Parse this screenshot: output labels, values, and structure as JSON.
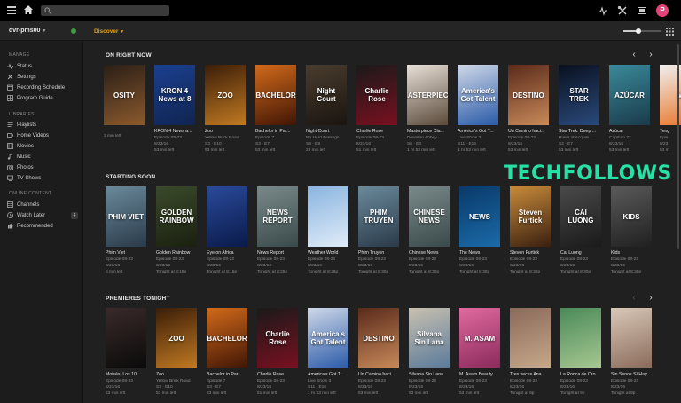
{
  "colors": {
    "accent": "#e5a00d",
    "watermark": "#27e0a6",
    "avatar": "#e5437a"
  },
  "topbar": {
    "search_placeholder": "",
    "avatar_letter": "P"
  },
  "subbar": {
    "server": "dvr-pms00",
    "discover": "Discover"
  },
  "sidebar": {
    "manage_head": "MANAGE",
    "manage": [
      "Status",
      "Settings",
      "Recording Schedule",
      "Program Guide"
    ],
    "libraries_head": "LIBRARIES",
    "libraries": [
      "Playlists",
      "Home Videos",
      "Movies",
      "Music",
      "Photos",
      "TV Shows"
    ],
    "online_head": "ONLINE CONTENT",
    "online": [
      "Channels",
      "Watch Later",
      "Recommended"
    ],
    "watch_later_badge": "4"
  },
  "watermark": "TECHFOLLOWS",
  "hubs": [
    {
      "title": "ON RIGHT NOW",
      "cards": [
        {
          "poster": "OSITY",
          "c1": "#2b1e16",
          "c2": "#8a5a2e",
          "title": "",
          "l2": "",
          "l3": "",
          "l4": "3 min left"
        },
        {
          "poster": "KRON 4 News at 8",
          "c1": "#1c3f8f",
          "c2": "#0f2450",
          "title": "KRON 4 News a...",
          "l2": "Episode 08-23",
          "l3": "8/23/16",
          "l4": "53 min left"
        },
        {
          "poster": "ZOO",
          "c1": "#3b1d08",
          "c2": "#c17a22",
          "title": "Zoo",
          "l2": "Yellow Brick Road",
          "l3": "S3 · E10",
          "l4": "53 min left"
        },
        {
          "poster": "BACHELOR",
          "c1": "#d26a1a",
          "c2": "#401505",
          "title": "Bachelor in Par...",
          "l2": "Episode 7",
          "l3": "S3 · E7",
          "l4": "53 min left"
        },
        {
          "poster": "Night Court",
          "c1": "#4a3d2e",
          "c2": "#1a1410",
          "title": "Night Court",
          "l2": "No Hard Feelings",
          "l3": "S9 · E8",
          "l4": "23 min left"
        },
        {
          "poster": "Charlie Rose",
          "c1": "#1a1a1a",
          "c2": "#7a1020",
          "title": "Charlie Rose",
          "l2": "Episode 08-23",
          "l3": "8/23/16",
          "l4": "51 min left"
        },
        {
          "poster": "MASTERPIECE",
          "c1": "#e8e0d8",
          "c2": "#5a4a3a",
          "title": "Masterpiece Cla...",
          "l2": "Downton Abbey...",
          "l3": "S6 · E3",
          "l4": "1 hr 53 min left"
        },
        {
          "poster": "America's Got Talent",
          "c1": "#cfd8e8",
          "c2": "#2a5aa8",
          "title": "America's Got T...",
          "l2": "Live Show 3",
          "l3": "S11 · E16",
          "l4": "1 hr 53 min left"
        },
        {
          "poster": "DESTINO",
          "c1": "#5a2a1a",
          "c2": "#c88a5a",
          "title": "Un Camino haci...",
          "l2": "Episode 08-23",
          "l3": "8/23/16",
          "l4": "53 min left"
        },
        {
          "poster": "STAR TREK",
          "c1": "#0a1020",
          "c2": "#2a4a7a",
          "title": "Star Trek: Deep ...",
          "l2": "Rules of Acquisi...",
          "l3": "S2 · E7",
          "l4": "53 min left"
        },
        {
          "poster": "AZÚCAR",
          "c1": "#3a8a9a",
          "c2": "#1a3a4a",
          "title": "Azúcar",
          "l2": "Capítulo 77",
          "l3": "8/23/16",
          "l4": "53 min left"
        },
        {
          "poster": "M",
          "c1": "#f0f0f0",
          "c2": "#e87020",
          "title": "Teng",
          "l2": "Epis",
          "l3": "8/23",
          "l4": "53 m"
        }
      ]
    },
    {
      "title": "STARTING SOON",
      "cards": [
        {
          "poster": "PHIM VIET",
          "c1": "#6a8a9a",
          "c2": "#2a3a4a",
          "title": "Phim Viet",
          "l2": "Episode 08-23",
          "l3": "8/23/16",
          "l4": "8 min left"
        },
        {
          "poster": "GOLDEN RAINBOW",
          "c1": "#3a4a2a",
          "c2": "#1a2010",
          "title": "Golden Rainbow",
          "l2": "Episode 08-23",
          "l3": "8/23/16",
          "l4": "Tonight at 8:15p"
        },
        {
          "poster": "",
          "c1": "#2a4a9a",
          "c2": "#0a1a4a",
          "title": "Eye on Africa",
          "l2": "Episode 08-23",
          "l3": "8/23/16",
          "l4": "Tonight at 8:15p"
        },
        {
          "poster": "NEWS REPORT",
          "c1": "#7a8a8a",
          "c2": "#3a4a4a",
          "title": "News Report",
          "l2": "Episode 08-23",
          "l3": "8/23/16",
          "l4": "Tonight at 8:25p"
        },
        {
          "poster": "",
          "c1": "#8ab4e0",
          "c2": "#e0ecf8",
          "title": "Weather World",
          "l2": "Episode 08-23",
          "l3": "8/23/16",
          "l4": "Tonight at 8:28p"
        },
        {
          "poster": "PHIM TRUYEN",
          "c1": "#6a8a9a",
          "c2": "#2a3a4a",
          "title": "Phim Truyen",
          "l2": "Episode 08-23",
          "l3": "8/23/16",
          "l4": "Tonight at 8:30p"
        },
        {
          "poster": "CHINESE NEWS",
          "c1": "#7a8a8a",
          "c2": "#3a4a4a",
          "title": "Chinese News",
          "l2": "Episode 08-23",
          "l3": "8/23/16",
          "l4": "Tonight at 8:30p"
        },
        {
          "poster": "NEWS",
          "c1": "#0a3a6a",
          "c2": "#1a6aa8",
          "title": "The News",
          "l2": "Episode 08-23",
          "l3": "8/23/16",
          "l4": "Tonight at 8:30p"
        },
        {
          "poster": "Steven Furtick",
          "c1": "#c88a3a",
          "c2": "#3a2010",
          "title": "Steven Furtick",
          "l2": "Episode 08-23",
          "l3": "8/23/16",
          "l4": "Tonight at 8:30p"
        },
        {
          "poster": "CAI LUONG",
          "c1": "#4a4a4a",
          "c2": "#1a1a1a",
          "title": "Cai Luong",
          "l2": "Episode 08-23",
          "l3": "8/23/16",
          "l4": "Tonight at 8:30p"
        },
        {
          "poster": "KIDS",
          "c1": "#5a5a5a",
          "c2": "#202020",
          "title": "Kids",
          "l2": "Episode 08-23",
          "l3": "8/23/16",
          "l4": "Tonight at 8:30p"
        }
      ]
    },
    {
      "title": "PREMIERES TONIGHT",
      "cards": [
        {
          "poster": "",
          "c1": "#3a2a2a",
          "c2": "#0a0a0a",
          "title": "Moisés, Los 10 ...",
          "l2": "Episode 08-23",
          "l3": "8/23/16",
          "l4": "53 min left"
        },
        {
          "poster": "ZOO",
          "c1": "#3b1d08",
          "c2": "#c17a22",
          "title": "Zoo",
          "l2": "Yellow Brick Road",
          "l3": "S3 · E10",
          "l4": "53 min left"
        },
        {
          "poster": "BACHELOR",
          "c1": "#d26a1a",
          "c2": "#401505",
          "title": "Bachelor in Par...",
          "l2": "Episode 7",
          "l3": "S3 · E7",
          "l4": "53 min left"
        },
        {
          "poster": "Charlie Rose",
          "c1": "#1a1a1a",
          "c2": "#7a1020",
          "title": "Charlie Rose",
          "l2": "Episode 08-23",
          "l3": "8/23/16",
          "l4": "51 min left"
        },
        {
          "poster": "America's Got Talent",
          "c1": "#cfd8e8",
          "c2": "#2a5aa8",
          "title": "America's Got T...",
          "l2": "Live Show 3",
          "l3": "S11 · E16",
          "l4": "1 hr 53 min left"
        },
        {
          "poster": "DESTINO",
          "c1": "#5a2a1a",
          "c2": "#c88a5a",
          "title": "Un Camino haci...",
          "l2": "Episode 08-23",
          "l3": "8/23/16",
          "l4": "53 min left"
        },
        {
          "poster": "Silvana Sin Lana",
          "c1": "#c8c0b0",
          "c2": "#5a7a9a",
          "title": "Silvana Sin Lana",
          "l2": "Episode 08-23",
          "l3": "8/23/16",
          "l4": "53 min left"
        },
        {
          "poster": "M. ASAM",
          "c1": "#e06aa0",
          "c2": "#8a2a5a",
          "title": "M. Asam Beauty",
          "l2": "Episode 08-23",
          "l3": "8/23/16",
          "l4": "53 min left"
        },
        {
          "poster": "",
          "c1": "#8a6a5a",
          "c2": "#c8a88a",
          "title": "Tres veces Ana",
          "l2": "Episode 08-23",
          "l3": "8/23/16",
          "l4": "Tonight at 9p"
        },
        {
          "poster": "",
          "c1": "#4a8a5a",
          "c2": "#a8c890",
          "title": "La Ronca de Oro",
          "l2": "Episode 08-23",
          "l3": "8/23/16",
          "l4": "Tonight at 9p"
        },
        {
          "poster": "",
          "c1": "#d8c8b8",
          "c2": "#8a6a5a",
          "title": "Sin Senos Sí Hay...",
          "l2": "Episode 08-23",
          "l3": "8/23/16",
          "l4": "Tonight at 9p"
        }
      ]
    }
  ]
}
